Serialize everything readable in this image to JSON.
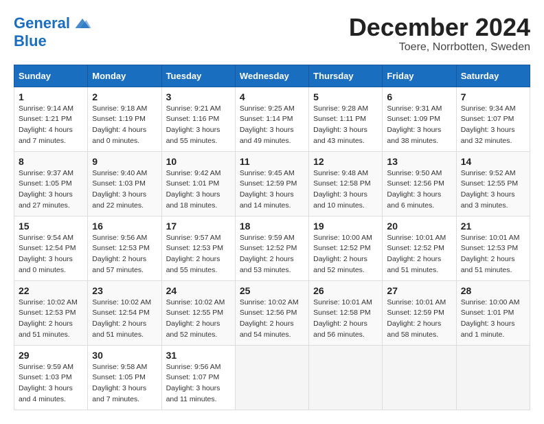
{
  "header": {
    "logo_line1": "General",
    "logo_line2": "Blue",
    "month_title": "December 2024",
    "location": "Toere, Norrbotten, Sweden"
  },
  "columns": [
    "Sunday",
    "Monday",
    "Tuesday",
    "Wednesday",
    "Thursday",
    "Friday",
    "Saturday"
  ],
  "weeks": [
    [
      {
        "day": "1",
        "sunrise": "Sunrise: 9:14 AM",
        "sunset": "Sunset: 1:21 PM",
        "daylight": "Daylight: 4 hours and 7 minutes."
      },
      {
        "day": "2",
        "sunrise": "Sunrise: 9:18 AM",
        "sunset": "Sunset: 1:19 PM",
        "daylight": "Daylight: 4 hours and 0 minutes."
      },
      {
        "day": "3",
        "sunrise": "Sunrise: 9:21 AM",
        "sunset": "Sunset: 1:16 PM",
        "daylight": "Daylight: 3 hours and 55 minutes."
      },
      {
        "day": "4",
        "sunrise": "Sunrise: 9:25 AM",
        "sunset": "Sunset: 1:14 PM",
        "daylight": "Daylight: 3 hours and 49 minutes."
      },
      {
        "day": "5",
        "sunrise": "Sunrise: 9:28 AM",
        "sunset": "Sunset: 1:11 PM",
        "daylight": "Daylight: 3 hours and 43 minutes."
      },
      {
        "day": "6",
        "sunrise": "Sunrise: 9:31 AM",
        "sunset": "Sunset: 1:09 PM",
        "daylight": "Daylight: 3 hours and 38 minutes."
      },
      {
        "day": "7",
        "sunrise": "Sunrise: 9:34 AM",
        "sunset": "Sunset: 1:07 PM",
        "daylight": "Daylight: 3 hours and 32 minutes."
      }
    ],
    [
      {
        "day": "8",
        "sunrise": "Sunrise: 9:37 AM",
        "sunset": "Sunset: 1:05 PM",
        "daylight": "Daylight: 3 hours and 27 minutes."
      },
      {
        "day": "9",
        "sunrise": "Sunrise: 9:40 AM",
        "sunset": "Sunset: 1:03 PM",
        "daylight": "Daylight: 3 hours and 22 minutes."
      },
      {
        "day": "10",
        "sunrise": "Sunrise: 9:42 AM",
        "sunset": "Sunset: 1:01 PM",
        "daylight": "Daylight: 3 hours and 18 minutes."
      },
      {
        "day": "11",
        "sunrise": "Sunrise: 9:45 AM",
        "sunset": "Sunset: 12:59 PM",
        "daylight": "Daylight: 3 hours and 14 minutes."
      },
      {
        "day": "12",
        "sunrise": "Sunrise: 9:48 AM",
        "sunset": "Sunset: 12:58 PM",
        "daylight": "Daylight: 3 hours and 10 minutes."
      },
      {
        "day": "13",
        "sunrise": "Sunrise: 9:50 AM",
        "sunset": "Sunset: 12:56 PM",
        "daylight": "Daylight: 3 hours and 6 minutes."
      },
      {
        "day": "14",
        "sunrise": "Sunrise: 9:52 AM",
        "sunset": "Sunset: 12:55 PM",
        "daylight": "Daylight: 3 hours and 3 minutes."
      }
    ],
    [
      {
        "day": "15",
        "sunrise": "Sunrise: 9:54 AM",
        "sunset": "Sunset: 12:54 PM",
        "daylight": "Daylight: 3 hours and 0 minutes."
      },
      {
        "day": "16",
        "sunrise": "Sunrise: 9:56 AM",
        "sunset": "Sunset: 12:53 PM",
        "daylight": "Daylight: 2 hours and 57 minutes."
      },
      {
        "day": "17",
        "sunrise": "Sunrise: 9:57 AM",
        "sunset": "Sunset: 12:53 PM",
        "daylight": "Daylight: 2 hours and 55 minutes."
      },
      {
        "day": "18",
        "sunrise": "Sunrise: 9:59 AM",
        "sunset": "Sunset: 12:52 PM",
        "daylight": "Daylight: 2 hours and 53 minutes."
      },
      {
        "day": "19",
        "sunrise": "Sunrise: 10:00 AM",
        "sunset": "Sunset: 12:52 PM",
        "daylight": "Daylight: 2 hours and 52 minutes."
      },
      {
        "day": "20",
        "sunrise": "Sunrise: 10:01 AM",
        "sunset": "Sunset: 12:52 PM",
        "daylight": "Daylight: 2 hours and 51 minutes."
      },
      {
        "day": "21",
        "sunrise": "Sunrise: 10:01 AM",
        "sunset": "Sunset: 12:53 PM",
        "daylight": "Daylight: 2 hours and 51 minutes."
      }
    ],
    [
      {
        "day": "22",
        "sunrise": "Sunrise: 10:02 AM",
        "sunset": "Sunset: 12:53 PM",
        "daylight": "Daylight: 2 hours and 51 minutes."
      },
      {
        "day": "23",
        "sunrise": "Sunrise: 10:02 AM",
        "sunset": "Sunset: 12:54 PM",
        "daylight": "Daylight: 2 hours and 51 minutes."
      },
      {
        "day": "24",
        "sunrise": "Sunrise: 10:02 AM",
        "sunset": "Sunset: 12:55 PM",
        "daylight": "Daylight: 2 hours and 52 minutes."
      },
      {
        "day": "25",
        "sunrise": "Sunrise: 10:02 AM",
        "sunset": "Sunset: 12:56 PM",
        "daylight": "Daylight: 2 hours and 54 minutes."
      },
      {
        "day": "26",
        "sunrise": "Sunrise: 10:01 AM",
        "sunset": "Sunset: 12:58 PM",
        "daylight": "Daylight: 2 hours and 56 minutes."
      },
      {
        "day": "27",
        "sunrise": "Sunrise: 10:01 AM",
        "sunset": "Sunset: 12:59 PM",
        "daylight": "Daylight: 2 hours and 58 minutes."
      },
      {
        "day": "28",
        "sunrise": "Sunrise: 10:00 AM",
        "sunset": "Sunset: 1:01 PM",
        "daylight": "Daylight: 3 hours and 1 minute."
      }
    ],
    [
      {
        "day": "29",
        "sunrise": "Sunrise: 9:59 AM",
        "sunset": "Sunset: 1:03 PM",
        "daylight": "Daylight: 3 hours and 4 minutes."
      },
      {
        "day": "30",
        "sunrise": "Sunrise: 9:58 AM",
        "sunset": "Sunset: 1:05 PM",
        "daylight": "Daylight: 3 hours and 7 minutes."
      },
      {
        "day": "31",
        "sunrise": "Sunrise: 9:56 AM",
        "sunset": "Sunset: 1:07 PM",
        "daylight": "Daylight: 3 hours and 11 minutes."
      },
      null,
      null,
      null,
      null
    ]
  ]
}
